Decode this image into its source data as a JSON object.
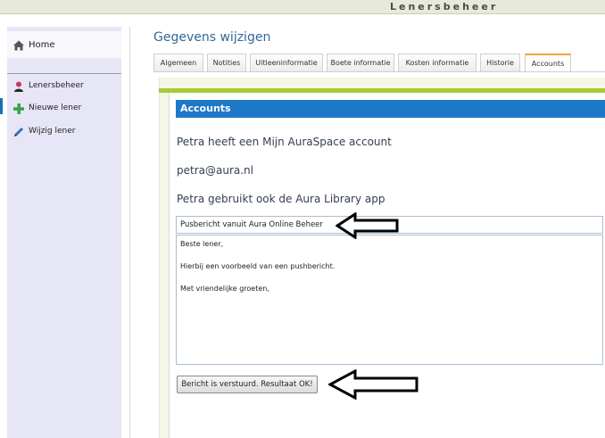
{
  "app": {
    "title": "Lenersbeheer"
  },
  "sidebar": {
    "home": {
      "label": "Home",
      "icon": "home-icon"
    },
    "items": [
      {
        "label": "Lenersbeheer",
        "icon": "user-icon"
      },
      {
        "label": "Nieuwe lener",
        "icon": "plus-icon"
      },
      {
        "label": "Wijzig lener",
        "icon": "pencil-icon"
      }
    ]
  },
  "page": {
    "title": "Gegevens wijzigen"
  },
  "tabs": [
    {
      "label": "Algemeen"
    },
    {
      "label": "Notities"
    },
    {
      "label": "Uitleeninformatie"
    },
    {
      "label": "Boete informatie"
    },
    {
      "label": "Kosten informatie"
    },
    {
      "label": "Historie"
    },
    {
      "label": "Accounts",
      "active": true
    }
  ],
  "accounts": {
    "header": "Accounts",
    "line1": "Petra heeft een Mijn AuraSpace account",
    "email": "petra@aura.nl",
    "line3": "Petra gebruikt ook de Aura Library app",
    "push_title": "Pusbericht vanuit Aura Online Beheer",
    "push_body": {
      "greeting": "Beste lener,",
      "text": "Hierbij een voorbeeld van een pushbericht.",
      "closing": "Met vriendelijke groeten,"
    },
    "result_button": "Bericht is verstuurd. Resultaat OK!"
  },
  "colors": {
    "accent_blue": "#1e78c8",
    "accent_green": "#a6cc36",
    "active_tab": "#f0a33a",
    "sidebar_bg": "#e7e6f6"
  }
}
